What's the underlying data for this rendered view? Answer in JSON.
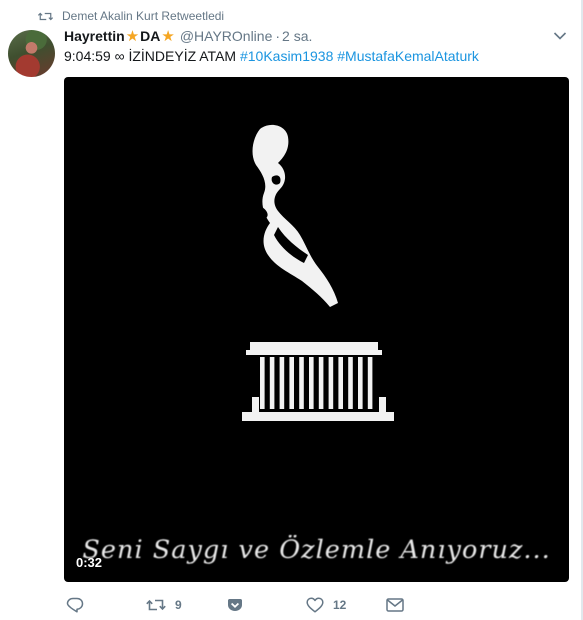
{
  "retweet_context": {
    "text": "Demet Akalin Kurt Retweetledi"
  },
  "author": {
    "name_part1": "Hayrettin",
    "name_part2": "DA",
    "star_glyph": "★",
    "handle": "@HAYROnline",
    "separator": "·",
    "time": "2 sa."
  },
  "tweet": {
    "text_prefix": "9:04:59 ∞ İZİNDEYİZ ATAM",
    "hashtags": [
      "#10Kasim1938",
      "#MustafaKemalAtaturk"
    ]
  },
  "media": {
    "caption": "Seni Saygı ve Özlemle Anıyoruz...",
    "duration": "0:32"
  },
  "actions": {
    "reply_count": "",
    "retweet_count": "9",
    "like_count": "12"
  },
  "colors": {
    "link": "#1b95e0",
    "muted": "#657786",
    "star": "#f5a623",
    "media_bg": "#000000"
  },
  "icons": {
    "retweet_context": "retweet-icon",
    "caret": "chevron-down-icon",
    "reply": "reply-icon",
    "retweet": "retweet-icon",
    "vote": "vote-icon",
    "like": "heart-icon",
    "dm": "envelope-icon"
  }
}
